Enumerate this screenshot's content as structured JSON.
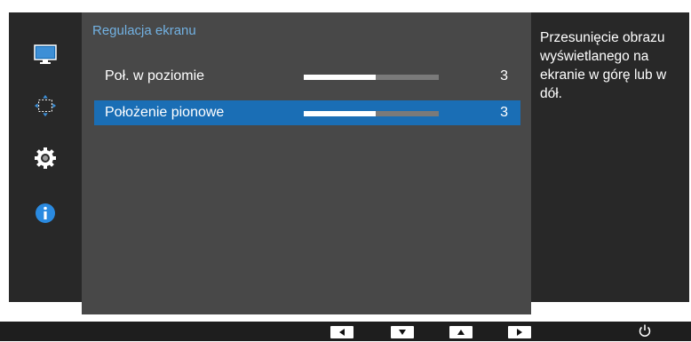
{
  "sidebar": {
    "icons": [
      "monitor-icon",
      "screen-position-icon",
      "gear-icon",
      "info-icon"
    ]
  },
  "menu": {
    "title": "Regulacja ekranu",
    "items": [
      {
        "label": "Poł. w poziomie",
        "value": "3",
        "level": 0.53,
        "selected": false
      },
      {
        "label": "Położenie pionowe",
        "value": "3",
        "level": 0.53,
        "selected": true
      }
    ]
  },
  "help": {
    "text": "Przesunięcie obrazu wyświetlanego na ekranie w górę lub w dół."
  },
  "bottom": {
    "buttons": [
      "left-arrow-icon",
      "down-arrow-icon",
      "up-arrow-icon",
      "right-arrow-icon",
      "power-icon"
    ]
  },
  "colors": {
    "title": "#72b1e2",
    "selected": "#1a6eb5",
    "panel": "#484848",
    "side": "#282828"
  }
}
